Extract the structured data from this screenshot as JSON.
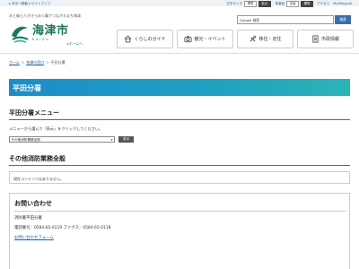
{
  "utility": {
    "links": [
      "本文へ移動",
      "サイトマップ"
    ],
    "font_size_label": "文字サイズ",
    "font_size_buttons": [
      "標準",
      "拡大"
    ],
    "color_label": "背景色",
    "color_buttons": [
      "反転",
      "標準"
    ],
    "access_label": "アクセス",
    "multilingual_label": "Multilingual"
  },
  "tagline": "水と緑と人がきらめく輪でつながるまち海津",
  "logo": {
    "title": "海津市",
    "roman": "KAIZU",
    "brand_color": "#1a7a55"
  },
  "home_link": "ホームへ",
  "search": {
    "value": "Google 検索",
    "button": "検索"
  },
  "nav": [
    {
      "label": "くらしのガイド",
      "icon": "house-icon"
    },
    {
      "label": "観光・イベント",
      "icon": "camera-icon"
    },
    {
      "label": "移住・定住",
      "icon": "tools-icon"
    },
    {
      "label": "市政情報",
      "icon": "document-icon"
    }
  ],
  "breadcrumb": {
    "items": [
      "ホーム",
      "各課の窓口"
    ],
    "current": "平田分署"
  },
  "page_title": "平田分署",
  "menu": {
    "title": "平田分署メニュー",
    "instruction": "メニューから選んで「表示」をクリックしてください。",
    "select_value": "その他消防業務全般",
    "button": "表示"
  },
  "other": {
    "title": "その他消防業務全般",
    "empty_text": "現在コンテンツはありません。"
  },
  "contact": {
    "title": "お問い合わせ",
    "department": "消防署平田分署",
    "phone": "電話番号：0584-65-0119 ファクス：0584-65-0118",
    "form_link": "お問い合わせフォーム"
  },
  "colors": {
    "accent": "#3a6eb0",
    "banner_start": "#1c8dc8",
    "banner_end": "#2bb4b8"
  }
}
